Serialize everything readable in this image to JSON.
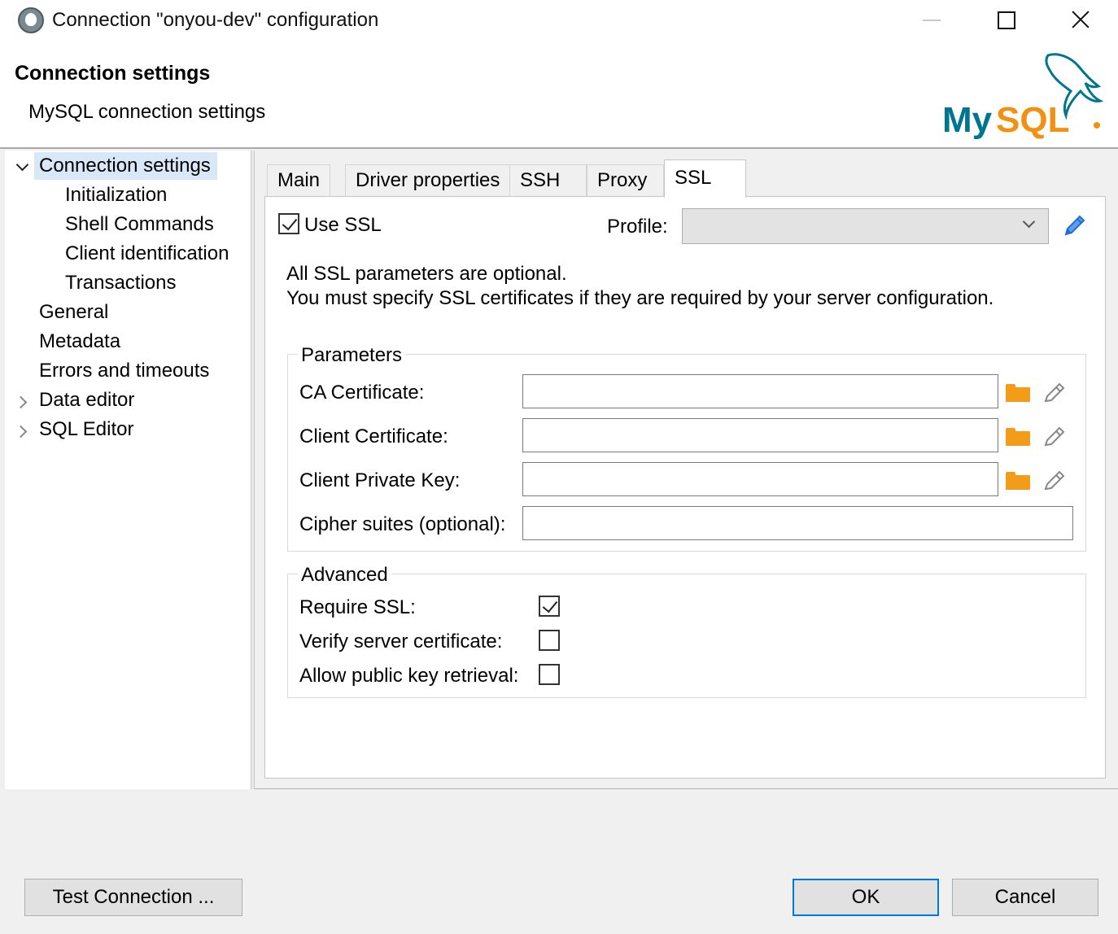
{
  "window": {
    "title": "Connection \"onyou-dev\" configuration",
    "controls": [
      "minimize",
      "maximize",
      "close"
    ]
  },
  "header": {
    "title": "Connection settings",
    "subtitle": "MySQL connection settings",
    "logo": "MySQL"
  },
  "tree": {
    "items": [
      {
        "label": "Connection settings",
        "expanded": true,
        "selected": true
      },
      {
        "label": "Initialization"
      },
      {
        "label": "Shell Commands"
      },
      {
        "label": "Client identification"
      },
      {
        "label": "Transactions"
      },
      {
        "label": "General"
      },
      {
        "label": "Metadata"
      },
      {
        "label": "Errors and timeouts"
      },
      {
        "label": "Data editor",
        "expandable": true
      },
      {
        "label": "SQL Editor",
        "expandable": true
      }
    ]
  },
  "tabs": [
    {
      "label": "Main"
    },
    {
      "label": "Driver properties"
    },
    {
      "label": "SSH"
    },
    {
      "label": "Proxy"
    },
    {
      "label": "SSL",
      "active": true
    }
  ],
  "ssl": {
    "use_ssl_label": "Use SSL",
    "use_ssl_checked": true,
    "profile_label": "Profile:",
    "profile_value": "",
    "info_line1": "All SSL parameters are optional.",
    "info_line2": "You must specify SSL certificates if they are required by your server configuration.",
    "parameters": {
      "title": "Parameters",
      "ca_certificate": {
        "label": "CA Certificate:",
        "value": ""
      },
      "client_certificate": {
        "label": "Client Certificate:",
        "value": ""
      },
      "client_private_key": {
        "label": "Client Private Key:",
        "value": ""
      },
      "cipher_suites": {
        "label": "Cipher suites (optional):",
        "value": ""
      }
    },
    "advanced": {
      "title": "Advanced",
      "require_ssl": {
        "label": "Require SSL:",
        "checked": true
      },
      "verify_server_certificate": {
        "label": "Verify server certificate:",
        "checked": false
      },
      "allow_public_key_retrieval": {
        "label": "Allow public key retrieval:",
        "checked": false
      }
    }
  },
  "buttons": {
    "test_connection": "Test Connection ...",
    "ok": "OK",
    "cancel": "Cancel"
  },
  "colors": {
    "selection": "#d9e8f8",
    "folder_icon": "#f39c1a",
    "edit_icon_blue": "#1e6fd9",
    "mysql_blue": "#00758f",
    "mysql_orange": "#f29111",
    "default_button_border": "#0078d7"
  },
  "icons": {
    "app": "dbeaver-beaver-icon",
    "profile_edit": "pencil-icon",
    "browse": "folder-icon",
    "clear": "eraser-icon"
  }
}
